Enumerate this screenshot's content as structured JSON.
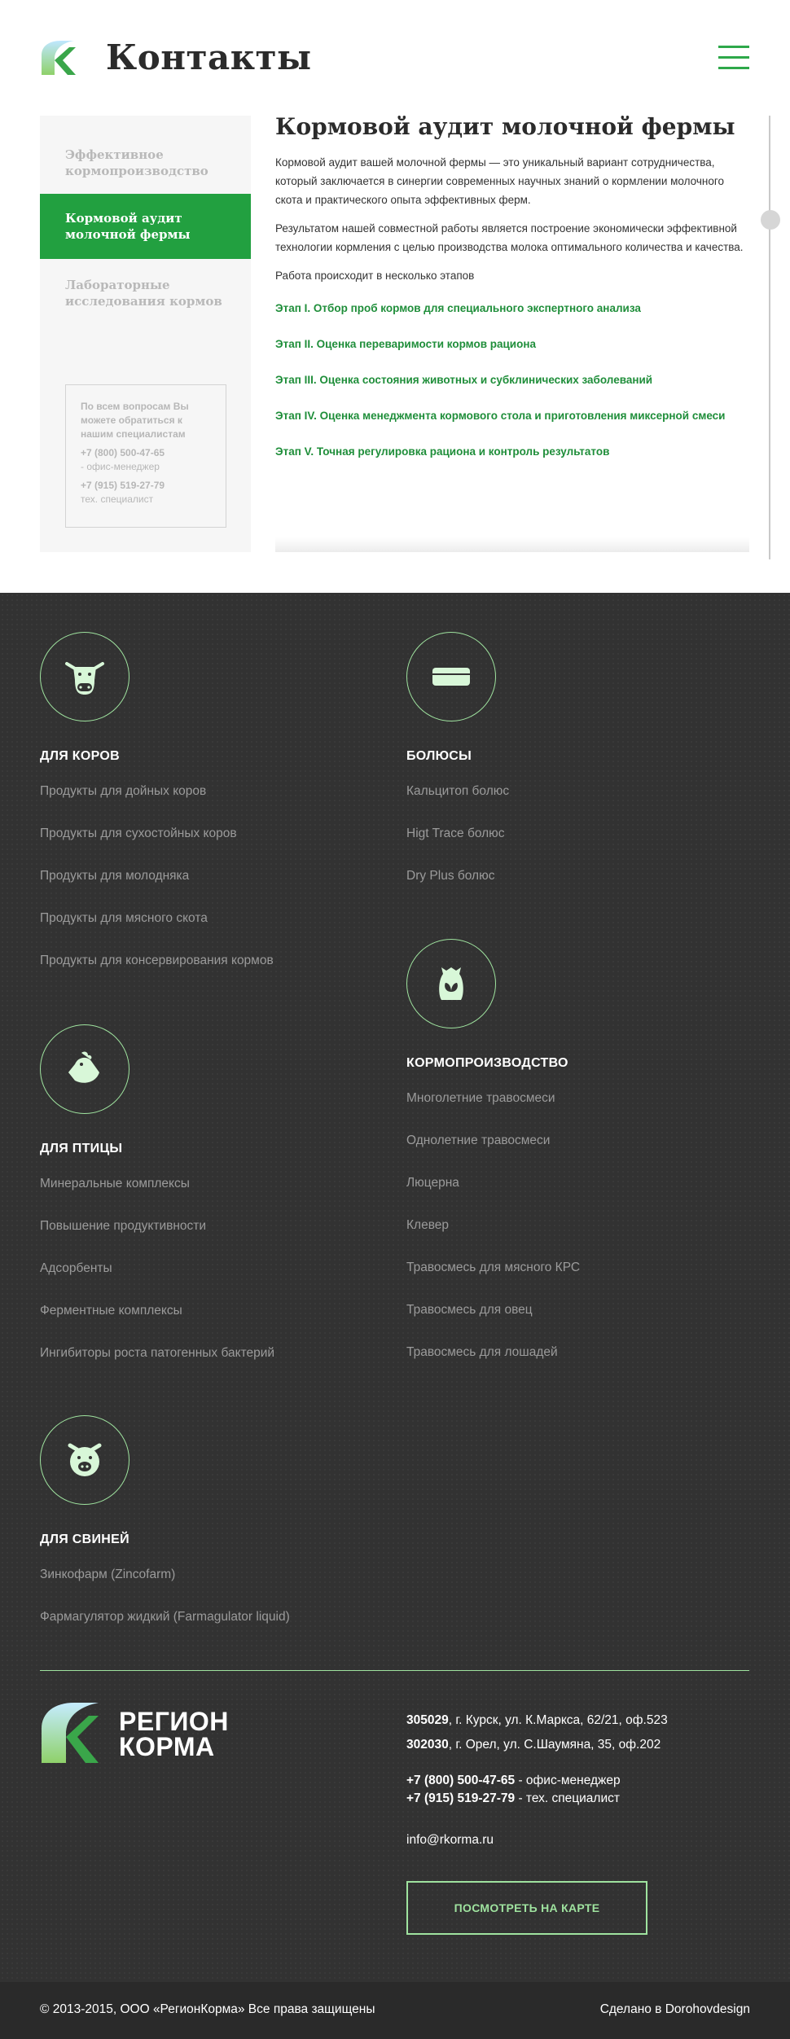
{
  "header": {
    "title": "Контакты"
  },
  "sidebar": {
    "items": [
      {
        "label": "Эффективное кормопроизводство"
      },
      {
        "label": "Кормовой аудит молочной фермы"
      },
      {
        "label": "Лабораторные исследования кормов"
      }
    ],
    "contact": {
      "question": "По всем вопросам Вы можете обратиться к нашим специалистам",
      "phone1": "+7 (800) 500-47-65",
      "role1": "- офис-менеджер",
      "phone2": "+7 (915) 519-27-79",
      "role2": "тех. специалист"
    }
  },
  "article": {
    "title": "Кормовой аудит молочной фермы",
    "p1": "Кормовой аудит вашей молочной фермы — это уникальный вариант сотрудничества, который заключается в синергии современных научных знаний о кормлении молочного скота и практического опыта эффективных ферм.",
    "p2": "Результатом нашей совместной работы является построение экономически эффективной технологии кормления с целью производства молока оптимального количества и качества.",
    "p3": "Работа происходит в несколько этапов",
    "stages": [
      "Этап I. Отбор проб кормов для специального экспертного анализа",
      "Этап II. Оценка переваримости кормов рациона",
      "Этап III. Оценка состояния животных и субклинических заболеваний",
      "Этап IV. Оценка менеджмента кормового стола и приготовления миксерной смеси",
      "Этап V. Точная регулировка рациона и контроль результатов"
    ]
  },
  "footer": {
    "categories": [
      {
        "title": "ДЛЯ КОРОВ",
        "icon": "cow-icon",
        "links": [
          "Продукты для дойных коров",
          "Продукты для сухостойных коров",
          "Продукты для молодняка",
          "Продукты для мясного скота",
          "Продукты для консервирования кормов"
        ]
      },
      {
        "title": "БОЛЮСЫ",
        "icon": "bolus-icon",
        "links": [
          "Кальцитоп болюс",
          "Higt Trace болюс",
          "Dry Plus болюс"
        ]
      },
      {
        "title": "ДЛЯ ПТИЦЫ",
        "icon": "chicken-icon",
        "links": [
          "Минеральные комплексы",
          "Повышение продуктивности",
          "Адсорбенты",
          "Ферментные комплексы",
          "Ингибиторы роста патогенных бактерий"
        ]
      },
      {
        "title": "КОРМОПРОИЗВОДСТВО",
        "icon": "seed-bag-icon",
        "links": [
          "Многолетние травосмеси",
          "Однолетние травосмеси",
          "Люцерна",
          "Клевер",
          "Травосмесь для мясного КРС",
          "Травосмесь для овец",
          "Травосмесь для лошадей"
        ]
      },
      {
        "title": "ДЛЯ СВИНЕЙ",
        "icon": "pig-icon",
        "links": [
          "Зинкофарм (Zincofarm)",
          "Фармагулятор жидкий (Farmagulator liquid)"
        ]
      }
    ],
    "brand": {
      "line1": "РЕГИОН",
      "line2": "КОРМА"
    },
    "address1": {
      "index": "305029",
      "text": ", г. Курск, ул. К.Маркса, 62/21, оф.523"
    },
    "address2": {
      "index": "302030",
      "text": ", г. Орел, ул. С.Шаумяна, 35, оф.202"
    },
    "phone1": {
      "number": "+7 (800) 500-47-65",
      "role": " - офис-менеджер"
    },
    "phone2": {
      "number": "+7 (915) 519-27-79",
      "role": " - тех. специалист"
    },
    "email": "info@rkorma.ru",
    "map_button": "ПОСМОТРЕТЬ НА КАРТЕ",
    "copyright": "© 2013-2015, ООО «РегионКорма»  Все права защищены",
    "made_by": "Сделано в Dorohovdesign"
  },
  "colors": {
    "accent": "#22a040",
    "link_green": "#1f8e3a",
    "outline_green": "#9fe39f",
    "footer_bg": "#323232"
  }
}
